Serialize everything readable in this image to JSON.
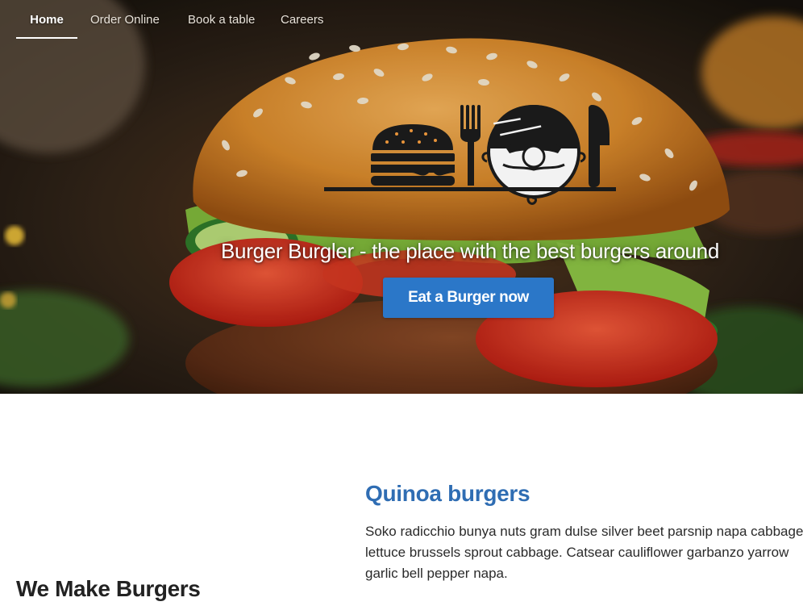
{
  "nav": {
    "items": [
      {
        "label": "Home",
        "active": true
      },
      {
        "label": "Order Online",
        "active": false
      },
      {
        "label": "Book a table",
        "active": false
      },
      {
        "label": "Careers",
        "active": false
      }
    ]
  },
  "hero": {
    "image": "burger-photo",
    "logo_icon": "burger-burgler-logo",
    "tagline": "Burger Burgler - the place with the best burgers around",
    "cta_label": "Eat a Burger now"
  },
  "feature": {
    "title": "Quinoa burgers",
    "text_lines": [
      "Soko radicchio bunya nuts gram dulse silver beet parsnip napa cabbage",
      "lettuce brussels sprout cabbage. Catsear cauliflower garbanzo yarrow",
      "garlic bell pepper napa."
    ]
  },
  "section": {
    "title": "We Make Burgers"
  },
  "colors": {
    "accent": "#2b77c8",
    "heading_blue": "#2f6db3",
    "nav_text": "#e9e3da",
    "text_dark": "#222222"
  }
}
